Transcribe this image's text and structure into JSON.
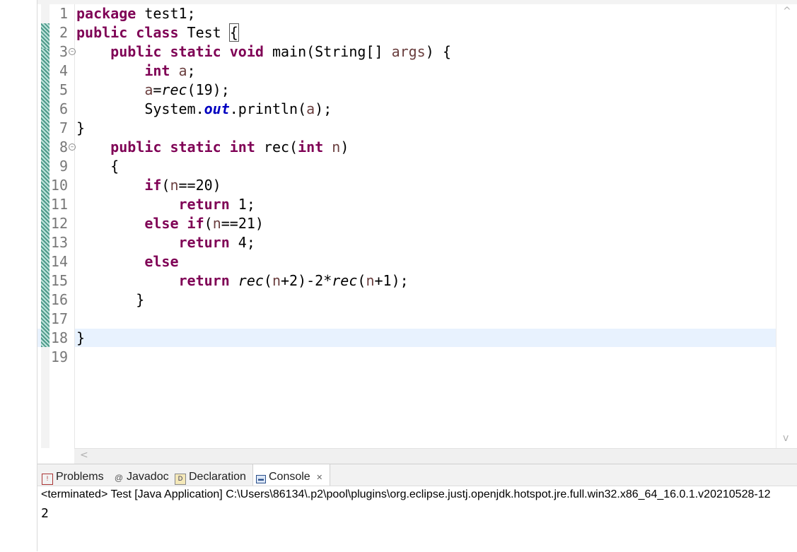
{
  "editor": {
    "line_numbers": [
      "1",
      "2",
      "3",
      "4",
      "5",
      "6",
      "7",
      "8",
      "9",
      "10",
      "11",
      "12",
      "13",
      "14",
      "15",
      "16",
      "17",
      "18",
      "19"
    ],
    "code": {
      "l1_kw": "package",
      "l1_rest": " test1;",
      "l2_kw1": "public",
      "l2_kw2": "class",
      "l2_name": " Test ",
      "l2_brace": "{",
      "l3_kw1": "public",
      "l3_kw2": "static",
      "l3_kw3": "void",
      "l3_m": " main(String[] ",
      "l3_var": "args",
      "l3_end": ") {",
      "l4_kw": "int",
      "l4_var": "a",
      "l4_end": ";",
      "l5_var": "a",
      "l5_eq": "=",
      "l5_call": "rec",
      "l5_end": "(19);",
      "l6_sys": "System.",
      "l6_fld": "out",
      "l6_mid": ".println(",
      "l6_var": "a",
      "l6_end": ");",
      "l7": "}",
      "l8_kw1": "public",
      "l8_kw2": "static",
      "l8_kw3": "int",
      "l8_m": " rec(",
      "l8_kw4": "int",
      "l8_var": "n",
      "l8_end": ")",
      "l9": "{",
      "l10_kw": "if",
      "l10_open": "(",
      "l10_var": "n",
      "l10_end": "==20)",
      "l11_kw": "return",
      "l11_end": " 1;",
      "l12_kw1": "else",
      "l12_kw2": "if",
      "l12_open": "(",
      "l12_var": "n",
      "l12_end": "==21)",
      "l13_kw": "return",
      "l13_end": " 4;",
      "l14_kw": "else",
      "l15_kw": "return",
      "l15_call1": "rec",
      "l15_a": "(",
      "l15_v1": "n",
      "l15_b": "+2)-2*",
      "l15_call2": "rec",
      "l15_c": "(",
      "l15_v2": "n",
      "l15_d": "+1);",
      "l16": "}",
      "l18": "}"
    }
  },
  "console": {
    "tabs": [
      {
        "label": "Problems",
        "icon": "problems-icon"
      },
      {
        "label": "Javadoc",
        "icon": "javadoc-icon"
      },
      {
        "label": "Declaration",
        "icon": "declaration-icon"
      },
      {
        "label": "Console",
        "icon": "console-icon"
      }
    ],
    "close_glyph": "✕",
    "status": "<terminated> Test [Java Application] C:\\Users\\86134\\.p2\\pool\\plugins\\org.eclipse.justj.openjdk.hotspot.jre.full.win32.x86_64_16.0.1.v20210528-12",
    "output": "2"
  },
  "colors": {
    "keyword": "#7f0055",
    "local_variable": "#6a3e3e",
    "static_field": "#0000c0",
    "current_line_highlight": "#e8f2fe",
    "quick_diff": "#4d9a8a"
  }
}
